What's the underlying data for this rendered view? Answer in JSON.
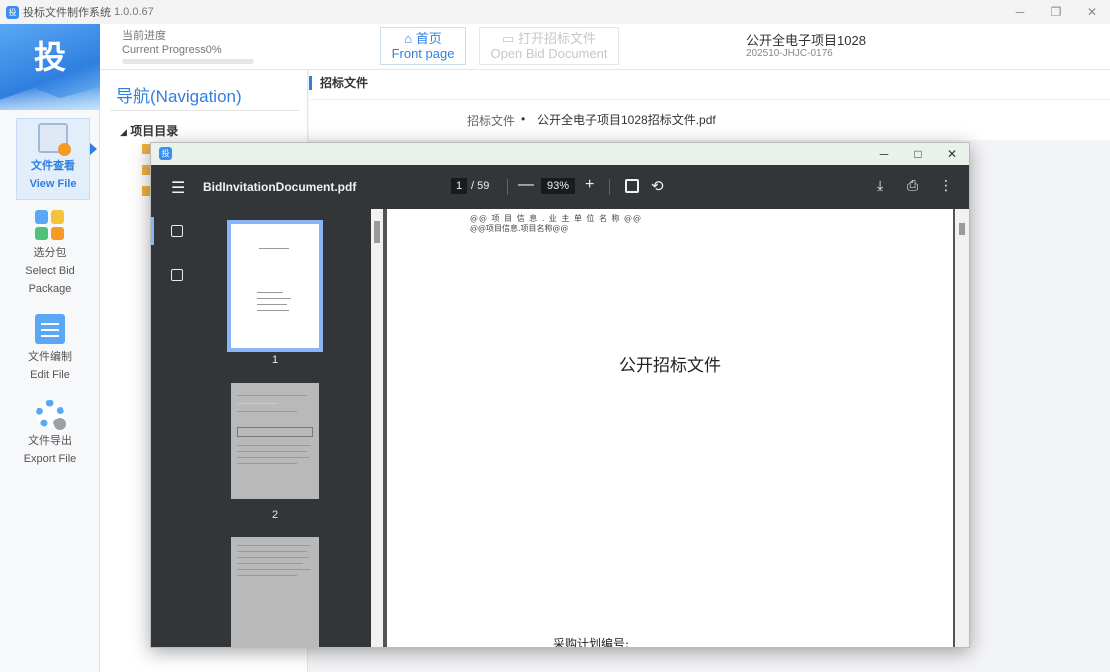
{
  "window": {
    "title": "投标文件制作系统",
    "version": "1.0.0.67",
    "app_icon": "投"
  },
  "sidebar": {
    "logo": "投",
    "items": [
      {
        "label_cn": "文件查看",
        "label_en": "View File",
        "icon": "file-view-icon",
        "active": true
      },
      {
        "label_cn": "选分包",
        "label_en": "Select Bid",
        "label_en2": "Package",
        "icon": "select-package-icon"
      },
      {
        "label_cn": "文件编制",
        "label_en": "Edit File",
        "icon": "edit-file-icon"
      },
      {
        "label_cn": "文件导出",
        "label_en": "Export File",
        "icon": "export-file-icon"
      }
    ]
  },
  "header": {
    "progress_cn": "当前进度",
    "progress_en": "Current Progress0%",
    "progress_value": 0,
    "home_cn": "首页",
    "home_en": "Front page",
    "open_cn": "打开招标文件",
    "open_en": "Open Bid Document",
    "project_name": "公开全电子项目1028",
    "project_code": "202510-JHJC-0176"
  },
  "navigation": {
    "title": "导航(Navigation)",
    "root": "项目目录"
  },
  "content": {
    "title": "招标文件",
    "breadcrumb_1": "招标文件",
    "breadcrumb_sep": "•",
    "breadcrumb_2": "公开全电子项目1028招标文件.pdf"
  },
  "pdf": {
    "window_icon": "投",
    "filename": "BidInvitationDocument.pdf",
    "current_page": "1",
    "total_pages": "/ 59",
    "zoom": "93%",
    "zoom_out": "—",
    "zoom_in": "+",
    "thumb_labels": [
      "1",
      "2"
    ],
    "page_header_1": "@@ 项 目 信 息 . 业 主 单 位 名 称 @@",
    "page_header_2": "@@项目信息.项目名称@@",
    "page_title": "公开招标文件",
    "page_footer": "采购计划编号:"
  },
  "colors": {
    "accent": "#2f7fe0",
    "toolbar": "#323639",
    "viewer_bg": "#525659"
  }
}
